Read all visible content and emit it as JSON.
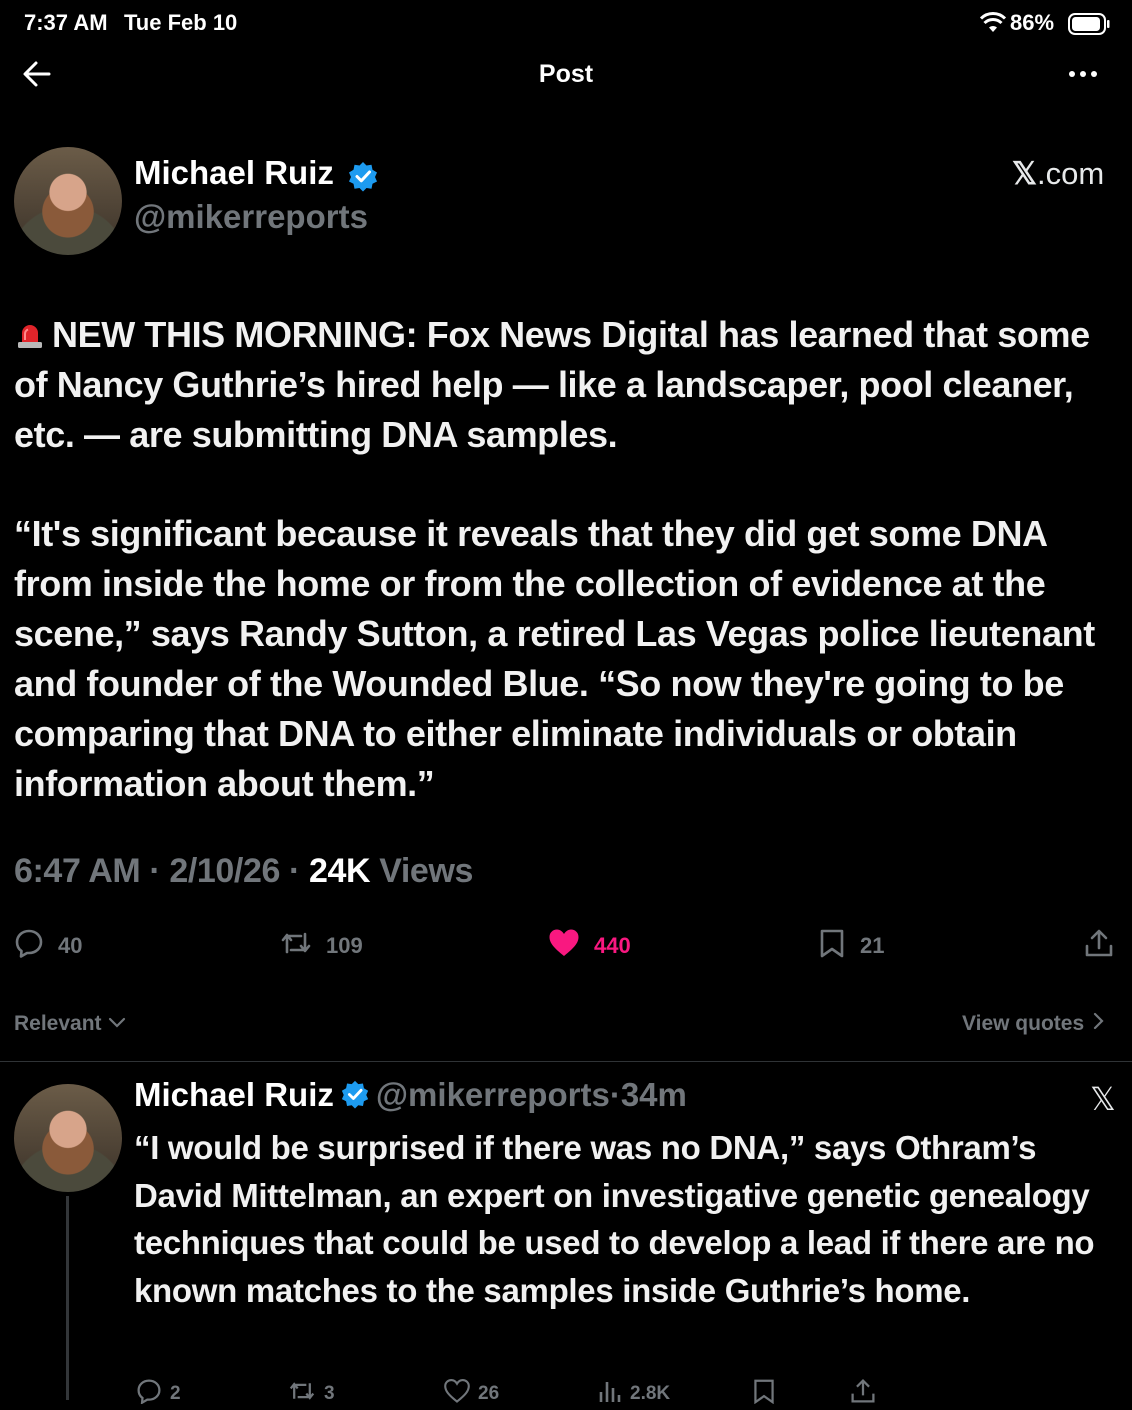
{
  "status_bar": {
    "time": "7:37 AM",
    "date": "Tue Feb 10",
    "battery": "86%"
  },
  "header": {
    "title": "Post"
  },
  "post": {
    "author_name": "Michael Ruiz",
    "author_handle": "@mikerreports",
    "source": ".com",
    "paragraph_1": "NEW THIS MORNING: Fox News Digital has learned that some of Nancy Guthrie’s hired help — like a landscaper, pool cleaner, etc. — are submitting DNA samples.",
    "paragraph_2": "“It's significant because it reveals that they did get some DNA from inside the home or from the collection of evidence at the scene,” says Randy Sutton, a retired Las Vegas police lieutenant and founder of the Wounded Blue. “So now they're going to be comparing that DNA to either eliminate individuals or obtain information about them.”",
    "time": "6:47 AM",
    "date": "2/10/26",
    "views_count": "24K",
    "views_label": "Views",
    "replies": "40",
    "reposts": "109",
    "likes": "440",
    "bookmarks": "21"
  },
  "sort": {
    "label": "Relevant",
    "view_quotes": "View quotes"
  },
  "reply": {
    "author_name": "Michael Ruiz",
    "author_handle": "@mikerreports",
    "age": "34m",
    "text": "“I would be surprised if there was no  DNA,” says Othram’s David Mittelman, an expert on investigative genetic genealogy techniques that could be used to develop a lead if there are no known matches to the samples inside Guthrie’s home.",
    "replies": "2",
    "reposts": "3",
    "likes": "26",
    "views": "2.8K"
  },
  "colors": {
    "background": "#000000",
    "muted": "#71767b",
    "like": "#f91880",
    "verified": "#1d9bf0"
  }
}
